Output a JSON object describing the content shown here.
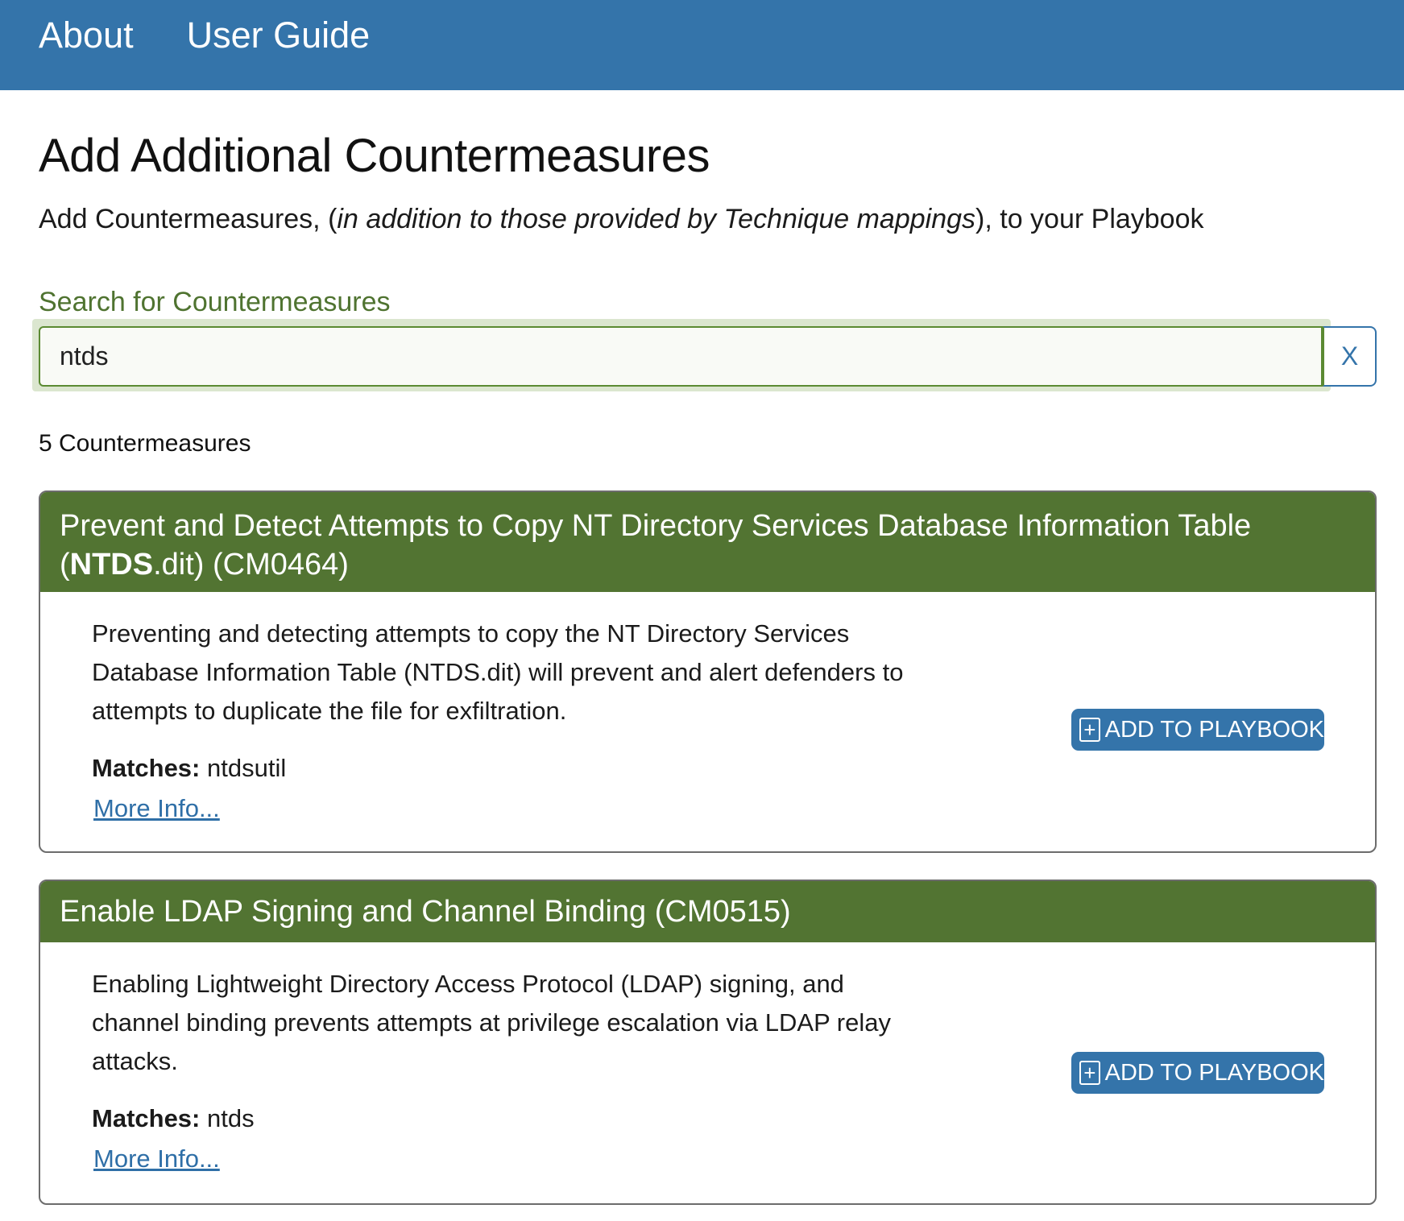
{
  "nav": {
    "items": [
      {
        "label": "About"
      },
      {
        "label": "User Guide"
      }
    ]
  },
  "page": {
    "title": "Add Additional Countermeasures",
    "subtitle_prefix": "Add Countermeasures, (",
    "subtitle_italic": "in addition to those provided by Technique mappings",
    "subtitle_suffix": "), to your Playbook"
  },
  "search": {
    "label": "Search for Countermeasures",
    "value": "ntds",
    "clear_label": "X"
  },
  "results": {
    "count_text": "5 Countermeasures",
    "add_button_label": "ADD TO PLAYBOOK",
    "add_button_icon": "plus-icon",
    "matches_label": "Matches:",
    "more_info_label": "More Info...",
    "items": [
      {
        "title_prefix": "Prevent and Detect Attempts to Copy NT Directory Services Database Information Table (",
        "title_highlight": "NTDS",
        "title_suffix": ".dit) (CM0464)",
        "description": "Preventing and detecting attempts to copy the NT Directory Services Database Information Table (NTDS.dit) will prevent and alert defenders to attempts to duplicate the file for exfiltration.",
        "matches": "ntdsutil"
      },
      {
        "title_prefix": "Enable LDAP Signing and Channel Binding (CM0515)",
        "title_highlight": "",
        "title_suffix": "",
        "description": "Enabling Lightweight Directory Access Protocol (LDAP) signing, and channel binding prevents attempts at privilege escalation via LDAP relay attacks.",
        "matches": "ntds"
      }
    ]
  },
  "colors": {
    "nav_bg": "#3474aa",
    "card_header_bg": "#527432",
    "search_label": "#4f7330",
    "link": "#2f6fa7"
  }
}
